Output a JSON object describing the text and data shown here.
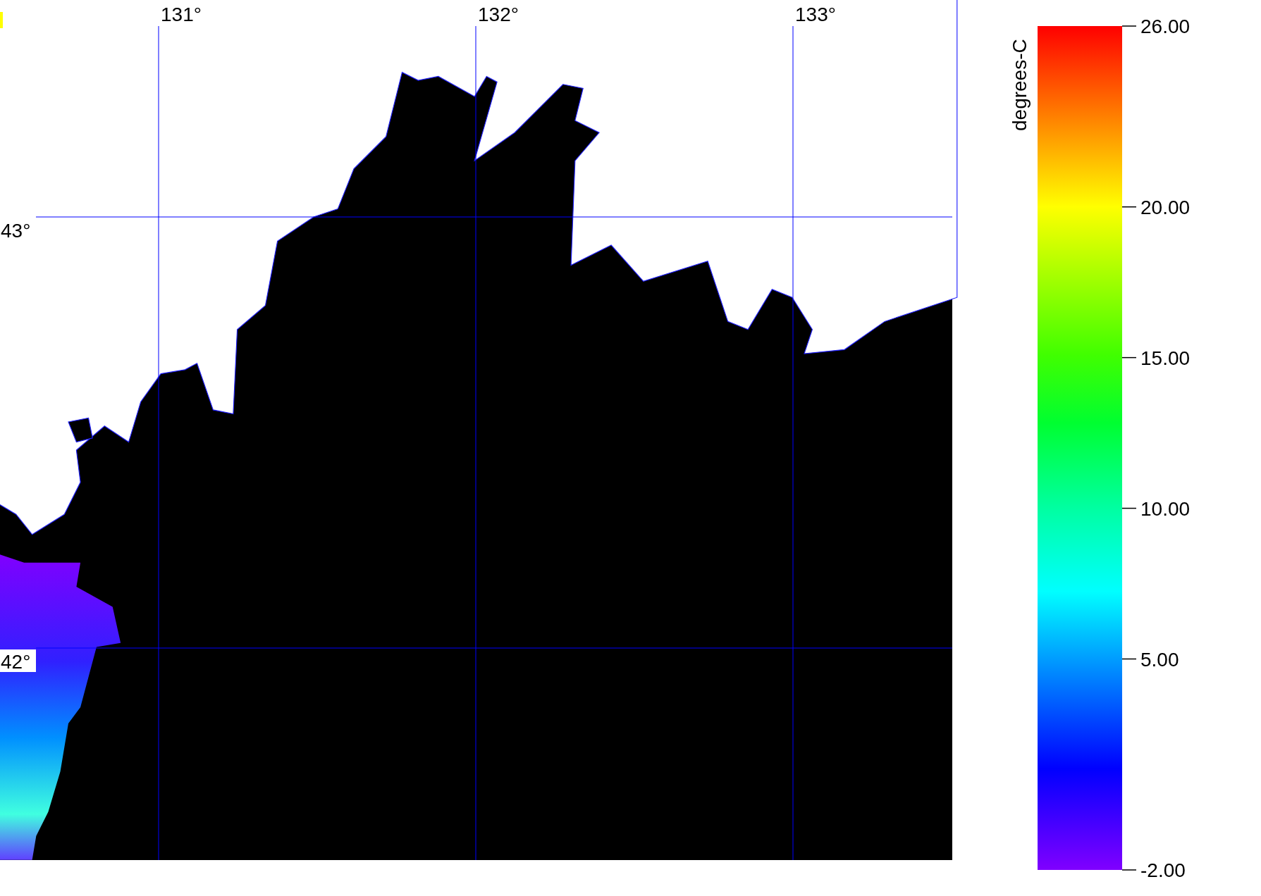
{
  "map": {
    "longitude_labels": [
      "131°",
      "132°",
      "133°"
    ],
    "latitude_labels": [
      "43°",
      "42°"
    ]
  },
  "color_scale": {
    "title": "degrees-C",
    "tick_labels": [
      "26.00",
      "20.00",
      "15.00",
      "10.00",
      "5.00",
      "-2.00"
    ]
  }
}
